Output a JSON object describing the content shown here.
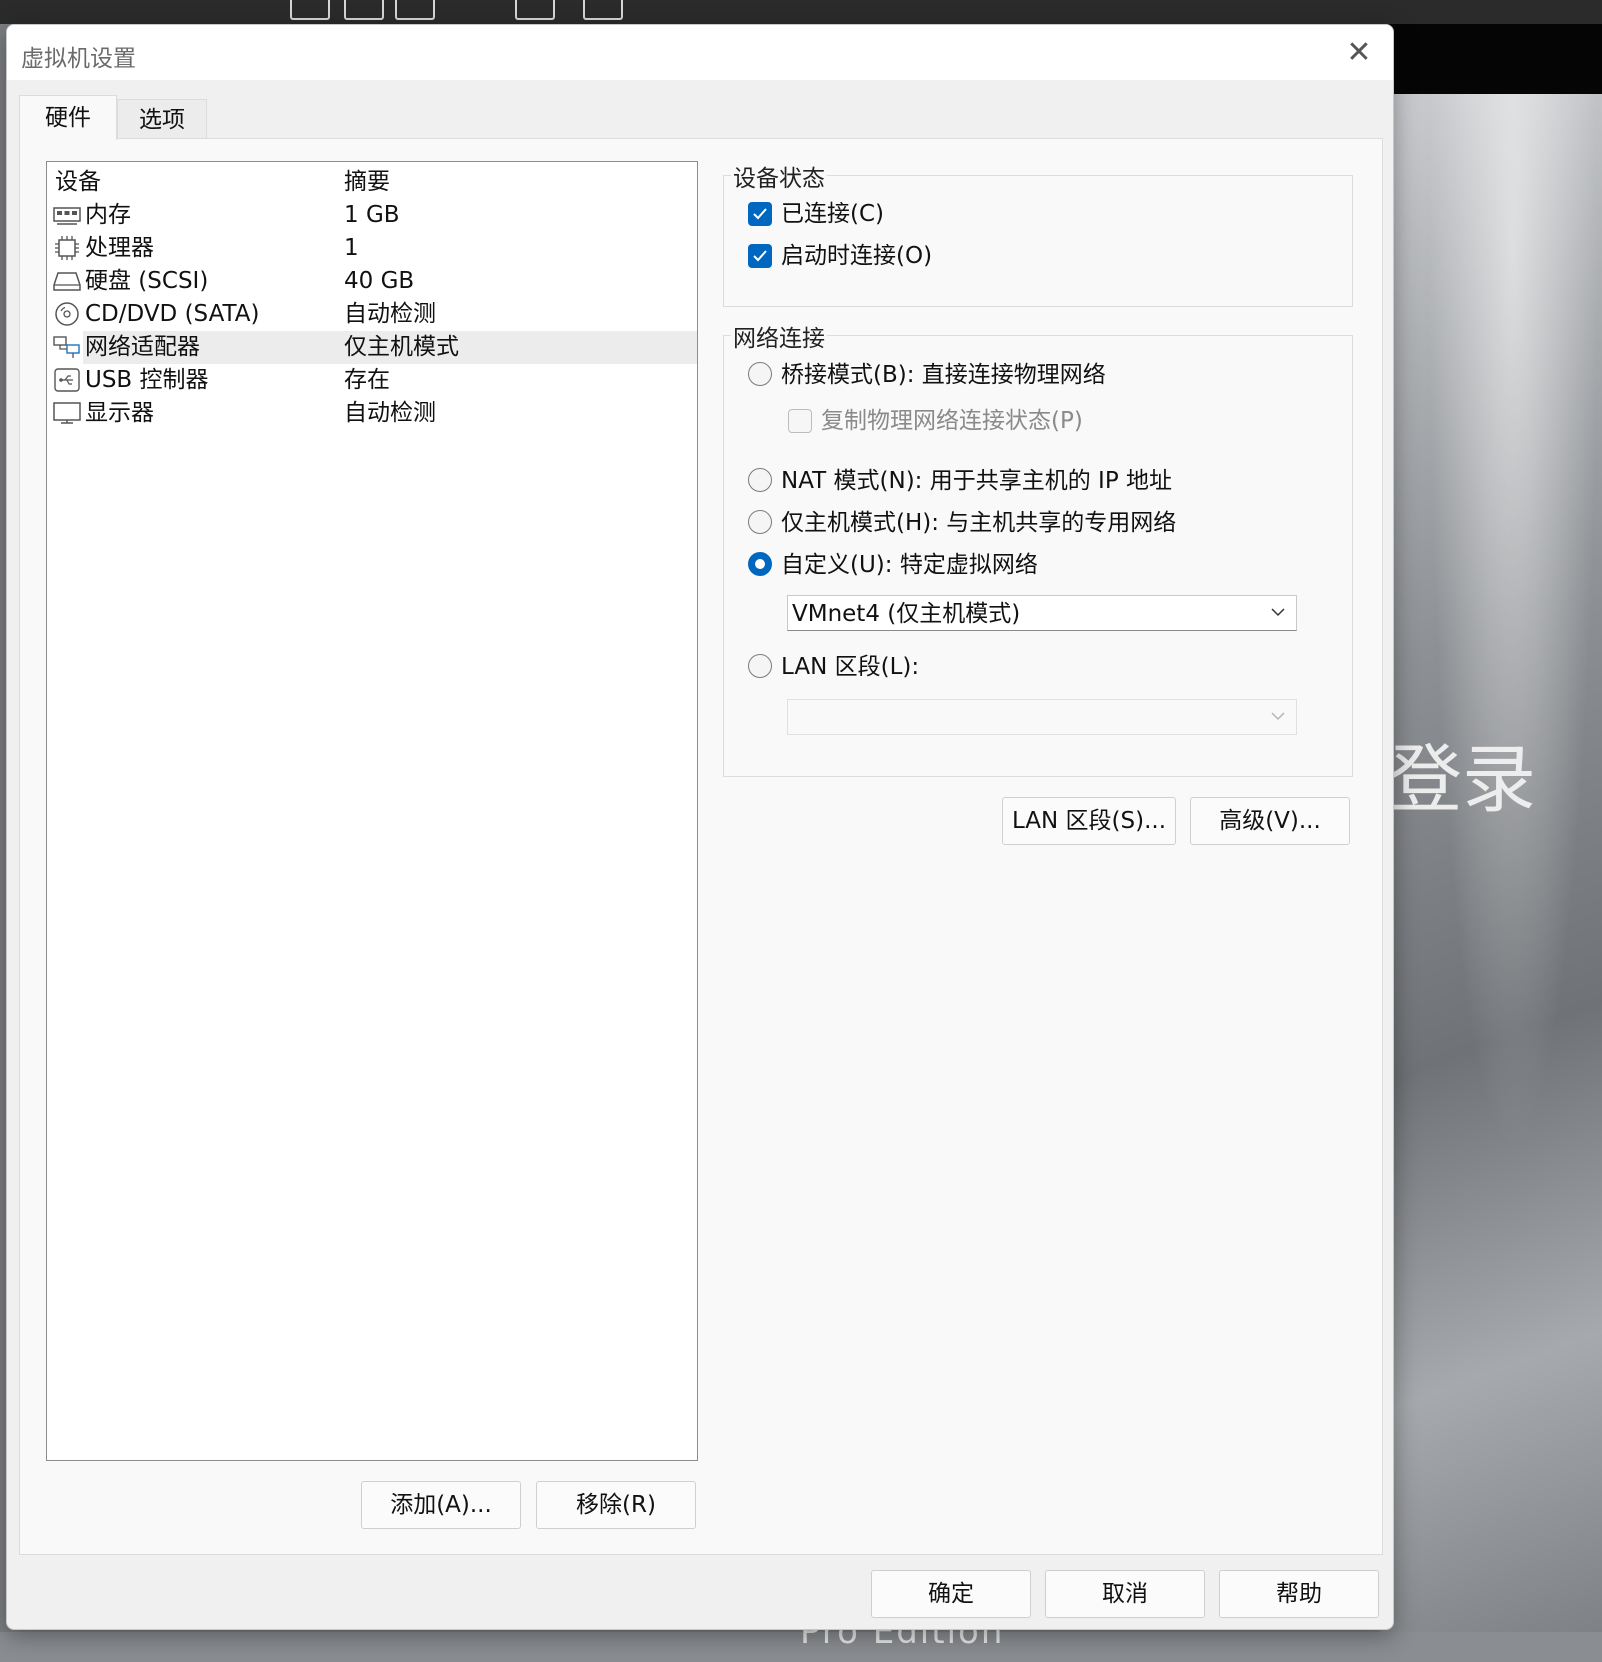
{
  "dialog": {
    "title": "虚拟机设置",
    "close_glyph": "✕"
  },
  "tabs": [
    {
      "label": "硬件",
      "active": true
    },
    {
      "label": "选项",
      "active": false
    }
  ],
  "device_list": {
    "headers": {
      "device": "设备",
      "summary": "摘要"
    },
    "rows": [
      {
        "icon": "memory-icon",
        "name": "内存",
        "summary": "1 GB"
      },
      {
        "icon": "processor-icon",
        "name": "处理器",
        "summary": "1"
      },
      {
        "icon": "harddisk-icon",
        "name": "硬盘 (SCSI)",
        "summary": "40 GB"
      },
      {
        "icon": "cd-dvd-icon",
        "name": "CD/DVD (SATA)",
        "summary": "自动检测"
      },
      {
        "icon": "network-adapter-icon",
        "name": "网络适配器",
        "summary": "仅主机模式",
        "selected": true
      },
      {
        "icon": "usb-icon",
        "name": "USB 控制器",
        "summary": "存在"
      },
      {
        "icon": "display-icon",
        "name": "显示器",
        "summary": "自动检测"
      }
    ]
  },
  "list_buttons": {
    "add": "添加(A)...",
    "remove": "移除(R)"
  },
  "device_status": {
    "title": "设备状态",
    "connected": {
      "label": "已连接(C)",
      "checked": true
    },
    "connect_at_power_on": {
      "label": "启动时连接(O)",
      "checked": true
    }
  },
  "network": {
    "title": "网络连接",
    "bridged": {
      "label": "桥接模式(B): 直接连接物理网络",
      "checked": false
    },
    "replicate": {
      "label": "复制物理网络连接状态(P)",
      "checked": false,
      "disabled": true
    },
    "nat": {
      "label": "NAT 模式(N): 用于共享主机的 IP 地址",
      "checked": false
    },
    "host_only": {
      "label": "仅主机模式(H): 与主机共享的专用网络",
      "checked": false
    },
    "custom": {
      "label": "自定义(U): 特定虚拟网络",
      "checked": true
    },
    "custom_select_value": "VMnet4 (仅主机模式)",
    "lan_segment": {
      "label": "LAN 区段(L):",
      "checked": false
    },
    "lan_select_value": ""
  },
  "network_buttons": {
    "lan_segments": "LAN 区段(S)...",
    "advanced": "高级(V)..."
  },
  "footer_buttons": {
    "ok": "确定",
    "cancel": "取消",
    "help": "帮助"
  },
  "background": {
    "login_text": "登录",
    "edition_text": "Pro Edition"
  },
  "colors": {
    "accent": "#0067c0",
    "selection": "#ececec"
  }
}
